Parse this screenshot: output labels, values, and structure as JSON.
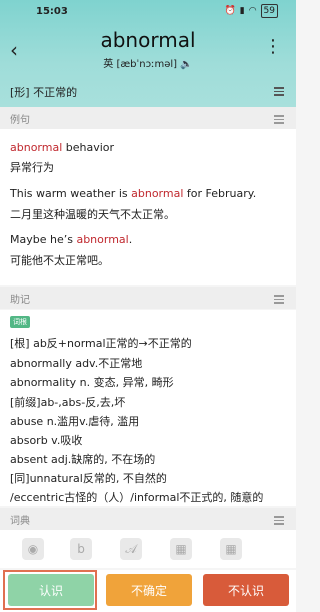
{
  "status": {
    "time": "15:03",
    "battery": "59"
  },
  "header": {
    "word": "abnormal",
    "phonetic": "英 [æbˈnɔːməl]",
    "speaker_icon": "speaker-icon",
    "part_of_speech": "[形] 不正常的"
  },
  "examples": {
    "title": "例句",
    "items": [
      {
        "en_before": "",
        "en_highlight": "abnormal",
        "en_after": " behavior",
        "zh": "异常行为"
      },
      {
        "en_before": "This warm weather is ",
        "en_highlight": "abnormal",
        "en_after": " for February.",
        "zh": "二月里这种温暖的天气不太正常。"
      },
      {
        "en_before": "Maybe he’s ",
        "en_highlight": "abnormal",
        "en_after": ".",
        "zh": "可能他不太正常吧。"
      }
    ]
  },
  "mnemonic": {
    "title": "助记",
    "tag": "词根",
    "lines": [
      "[根] ab反+normal正常的→不正常的",
      "abnormally adv.不正常地",
      "abnormality n.  变态, 异常, 畸形",
      "[前缀]ab-,abs-反,去,坏",
      "abuse  n.滥用v.虐待, 滥用",
      "absorb  v.吸收",
      "absent  adj.缺席的, 不在场的",
      "[同]unnatural反常的, 不自然的",
      "/eccentric古怪的（人）/informal不正式的, 随意的"
    ]
  },
  "dictionary": {
    "title": "词典",
    "icons": [
      "owl-icon",
      "bing-icon",
      "script-a-icon",
      "qr-icon",
      "qr-icon"
    ]
  },
  "actions": {
    "know": "认识",
    "unsure": "不确定",
    "unknown": "不认识"
  }
}
